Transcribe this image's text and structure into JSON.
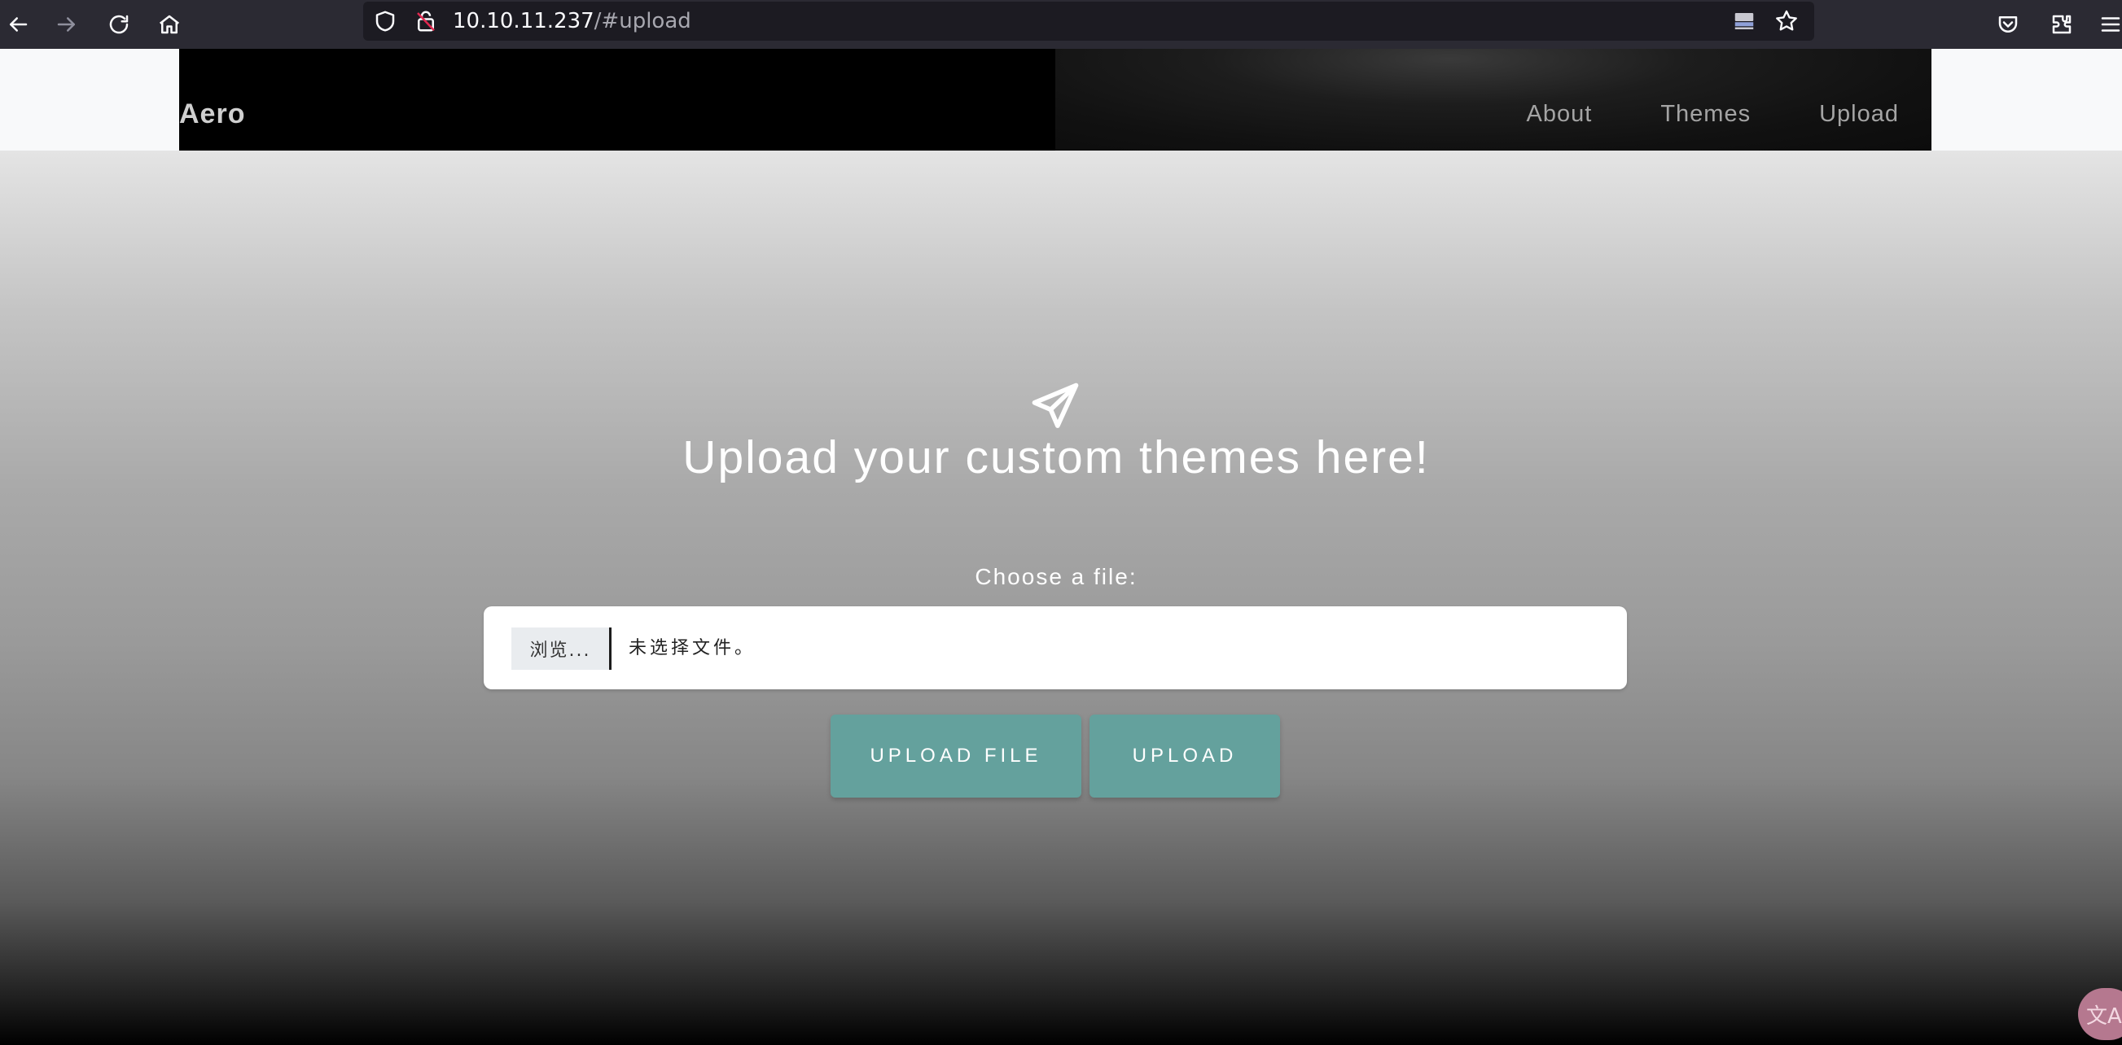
{
  "browser": {
    "url_host": "10.10.11.237",
    "url_path": "/#upload",
    "icons": [
      "back-icon",
      "forward-icon",
      "reload-icon",
      "home-icon",
      "shield-icon",
      "insecure-lock-icon",
      "reader-view-icon",
      "bookmark-star-icon",
      "pocket-icon",
      "extensions-icon",
      "menu-icon"
    ]
  },
  "navbar": {
    "brand": "Aero",
    "links": [
      "About",
      "Themes",
      "Upload"
    ]
  },
  "main": {
    "icon": "paper-plane-icon",
    "headline": "Upload your custom themes here!",
    "choose_label": "Choose a file:",
    "file_input": {
      "browse_label": "浏览...",
      "no_file_text": "未选择文件。"
    },
    "buttons": {
      "upload_file": "UPLOAD FILE",
      "upload": "UPLOAD"
    }
  },
  "overlay": {
    "translate_badge": "文A"
  },
  "colors": {
    "accent": "#64a19d",
    "toolbar": "#2b2a33",
    "urlbar": "#1c1b22"
  }
}
